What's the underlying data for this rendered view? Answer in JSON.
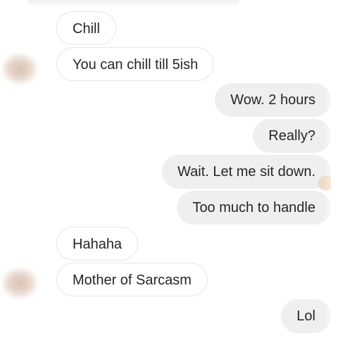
{
  "messages": [
    {
      "side": "received",
      "text": "Chill"
    },
    {
      "side": "received",
      "text": "You can chill till 5ish"
    },
    {
      "side": "sent",
      "text": "Wow. 2 hours"
    },
    {
      "side": "sent",
      "text": "Really?"
    },
    {
      "side": "sent",
      "text": "Wait. Let me sit down."
    },
    {
      "side": "sent",
      "text": "Too much to handle"
    },
    {
      "side": "received",
      "text": "Hahaha"
    },
    {
      "side": "received",
      "text": "Mother of Sarcasm"
    },
    {
      "side": "sent",
      "text": "Lol"
    }
  ],
  "colors": {
    "sent_bubble": "#efefef",
    "received_bubble": "#ffffff",
    "received_border": "#e6e6e6",
    "text": "#262626"
  }
}
